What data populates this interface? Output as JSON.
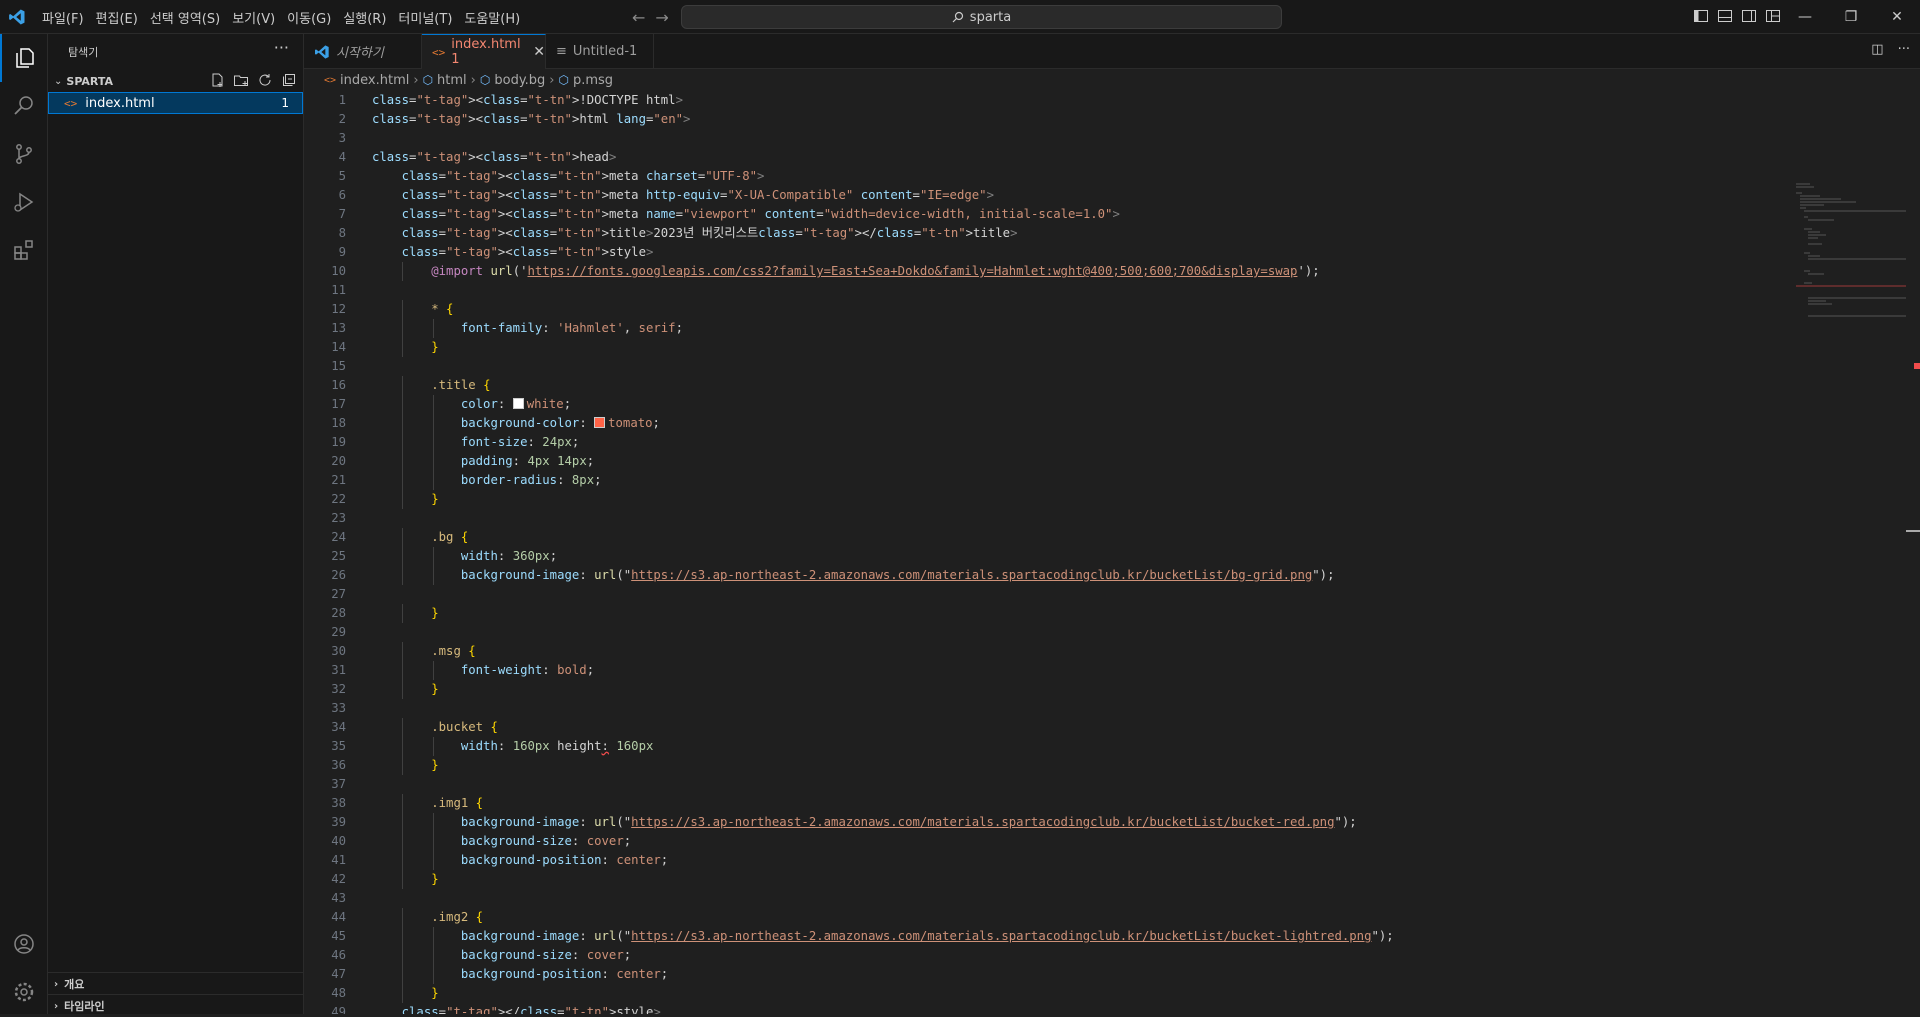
{
  "menu": [
    "파일(F)",
    "편집(E)",
    "선택 영역(S)",
    "보기(V)",
    "이동(G)",
    "실행(R)",
    "터미널(T)",
    "도움말(H)"
  ],
  "search": {
    "label": "sparta"
  },
  "sidebar": {
    "title": "탐색기",
    "section": "SPARTA",
    "file": {
      "icon": "<>",
      "name": "index.html",
      "badge": "1"
    },
    "outline": "개요",
    "timeline": "타임라인"
  },
  "tabs": [
    {
      "label": "시작하기",
      "icon": "vscode-icon"
    },
    {
      "label": "index.html 1",
      "icon": "html-icon",
      "active": true
    },
    {
      "label": "Untitled-1",
      "icon": "file-icon"
    }
  ],
  "breadcrumb": [
    "index.html",
    "html",
    "body.bg",
    "p.msg"
  ],
  "code": [
    [
      1,
      "<!DOCTYPE html>"
    ],
    [
      2,
      "<html lang=\"en\">"
    ],
    [
      3,
      ""
    ],
    [
      4,
      "<head>"
    ],
    [
      5,
      "    <meta charset=\"UTF-8\">"
    ],
    [
      6,
      "    <meta http-equiv=\"X-UA-Compatible\" content=\"IE=edge\">"
    ],
    [
      7,
      "    <meta name=\"viewport\" content=\"width=device-width, initial-scale=1.0\">"
    ],
    [
      8,
      "    <title>2023년 버킷리스트</title>"
    ],
    [
      9,
      "    <style>"
    ],
    [
      10,
      "        @import url('https://fonts.googleapis.com/css2?family=East+Sea+Dokdo&family=Hahmlet:wght@400;500;600;700&display=swap');"
    ],
    [
      11,
      ""
    ],
    [
      12,
      "        * {"
    ],
    [
      13,
      "            font-family: 'Hahmlet', serif;"
    ],
    [
      14,
      "        }"
    ],
    [
      15,
      ""
    ],
    [
      16,
      "        .title {"
    ],
    [
      17,
      "            color: white;"
    ],
    [
      18,
      "            background-color: tomato;"
    ],
    [
      19,
      "            font-size: 24px;"
    ],
    [
      20,
      "            padding: 4px 14px;"
    ],
    [
      21,
      "            border-radius: 8px;"
    ],
    [
      22,
      "        }"
    ],
    [
      23,
      ""
    ],
    [
      24,
      "        .bg {"
    ],
    [
      25,
      "            width: 360px;"
    ],
    [
      26,
      "            background-image: url(\"https://s3.ap-northeast-2.amazonaws.com/materials.spartacodingclub.kr/bucketList/bg-grid.png\");"
    ],
    [
      27,
      ""
    ],
    [
      28,
      "        }"
    ],
    [
      29,
      ""
    ],
    [
      30,
      "        .msg {"
    ],
    [
      31,
      "            font-weight: bold;"
    ],
    [
      32,
      "        }"
    ],
    [
      33,
      ""
    ],
    [
      34,
      "        .bucket {"
    ],
    [
      35,
      "            width: 160px height: 160px"
    ],
    [
      36,
      "        }"
    ],
    [
      37,
      ""
    ],
    [
      38,
      "        .img1 {"
    ],
    [
      39,
      "            background-image: url(\"https://s3.ap-northeast-2.amazonaws.com/materials.spartacodingclub.kr/bucketList/bucket-red.png\");"
    ],
    [
      40,
      "            background-size: cover;"
    ],
    [
      41,
      "            background-position: center;"
    ],
    [
      42,
      "        }"
    ],
    [
      43,
      ""
    ],
    [
      44,
      "        .img2 {"
    ],
    [
      45,
      "            background-image: url(\"https://s3.ap-northeast-2.amazonaws.com/materials.spartacodingclub.kr/bucketList/bucket-lightred.png\");"
    ],
    [
      46,
      "            background-size: cover;"
    ],
    [
      47,
      "            background-position: center;"
    ],
    [
      48,
      "        }"
    ],
    [
      49,
      "    </style>"
    ]
  ],
  "colors": {
    "accent": "#0078d4",
    "error": "#f14c4c",
    "tomato": "#ff6347",
    "white": "#ffffff"
  }
}
